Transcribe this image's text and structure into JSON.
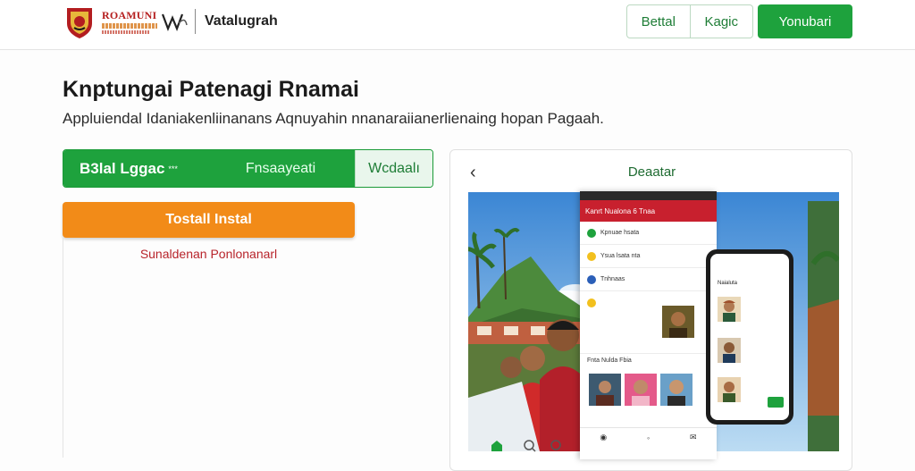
{
  "header": {
    "logo_text": "ROAMUNI",
    "logo_mark_text": "wa",
    "site_title": "Vatalugrah",
    "btn_group": [
      "Bettal",
      "Kagic"
    ],
    "primary_btn": "Yonubari"
  },
  "hero": {
    "title": "Knptungai Patenagi Rnamai",
    "description": "Appluiendal Idaniakenliinanans Aqnuyahin nnanaraiianerlienaing hopan Pagaah."
  },
  "tabs": {
    "active_label": "B3lal Lggac",
    "active_sup": "***",
    "second_label": "Fnsaayeati",
    "third_label": "Wcdaalı"
  },
  "install": {
    "button_label": "Tostall Instal",
    "note": "Sunaldenan Ponlonanarl"
  },
  "preview": {
    "back_icon": "‹",
    "title": "Deaatar",
    "phone1_header": "Kanrt Nualona 6 Tnaa",
    "phone1_rows": [
      "Kpnuae hsata",
      "Ysua lsata nta",
      "Tnhnaas"
    ],
    "phone1_section": "Fnta Nulda Fbia",
    "phone2_header": "Naialuta"
  },
  "colors": {
    "brand_green": "#1ea23d",
    "accent_orange": "#f28b18",
    "alert_red": "#b8242b",
    "phone_red": "#c8202e"
  },
  "icons": [
    "emblem-icon",
    "logo-mark-icon",
    "back-icon",
    "home-icon",
    "search-icon",
    "chat-icon",
    "profile-icon"
  ]
}
